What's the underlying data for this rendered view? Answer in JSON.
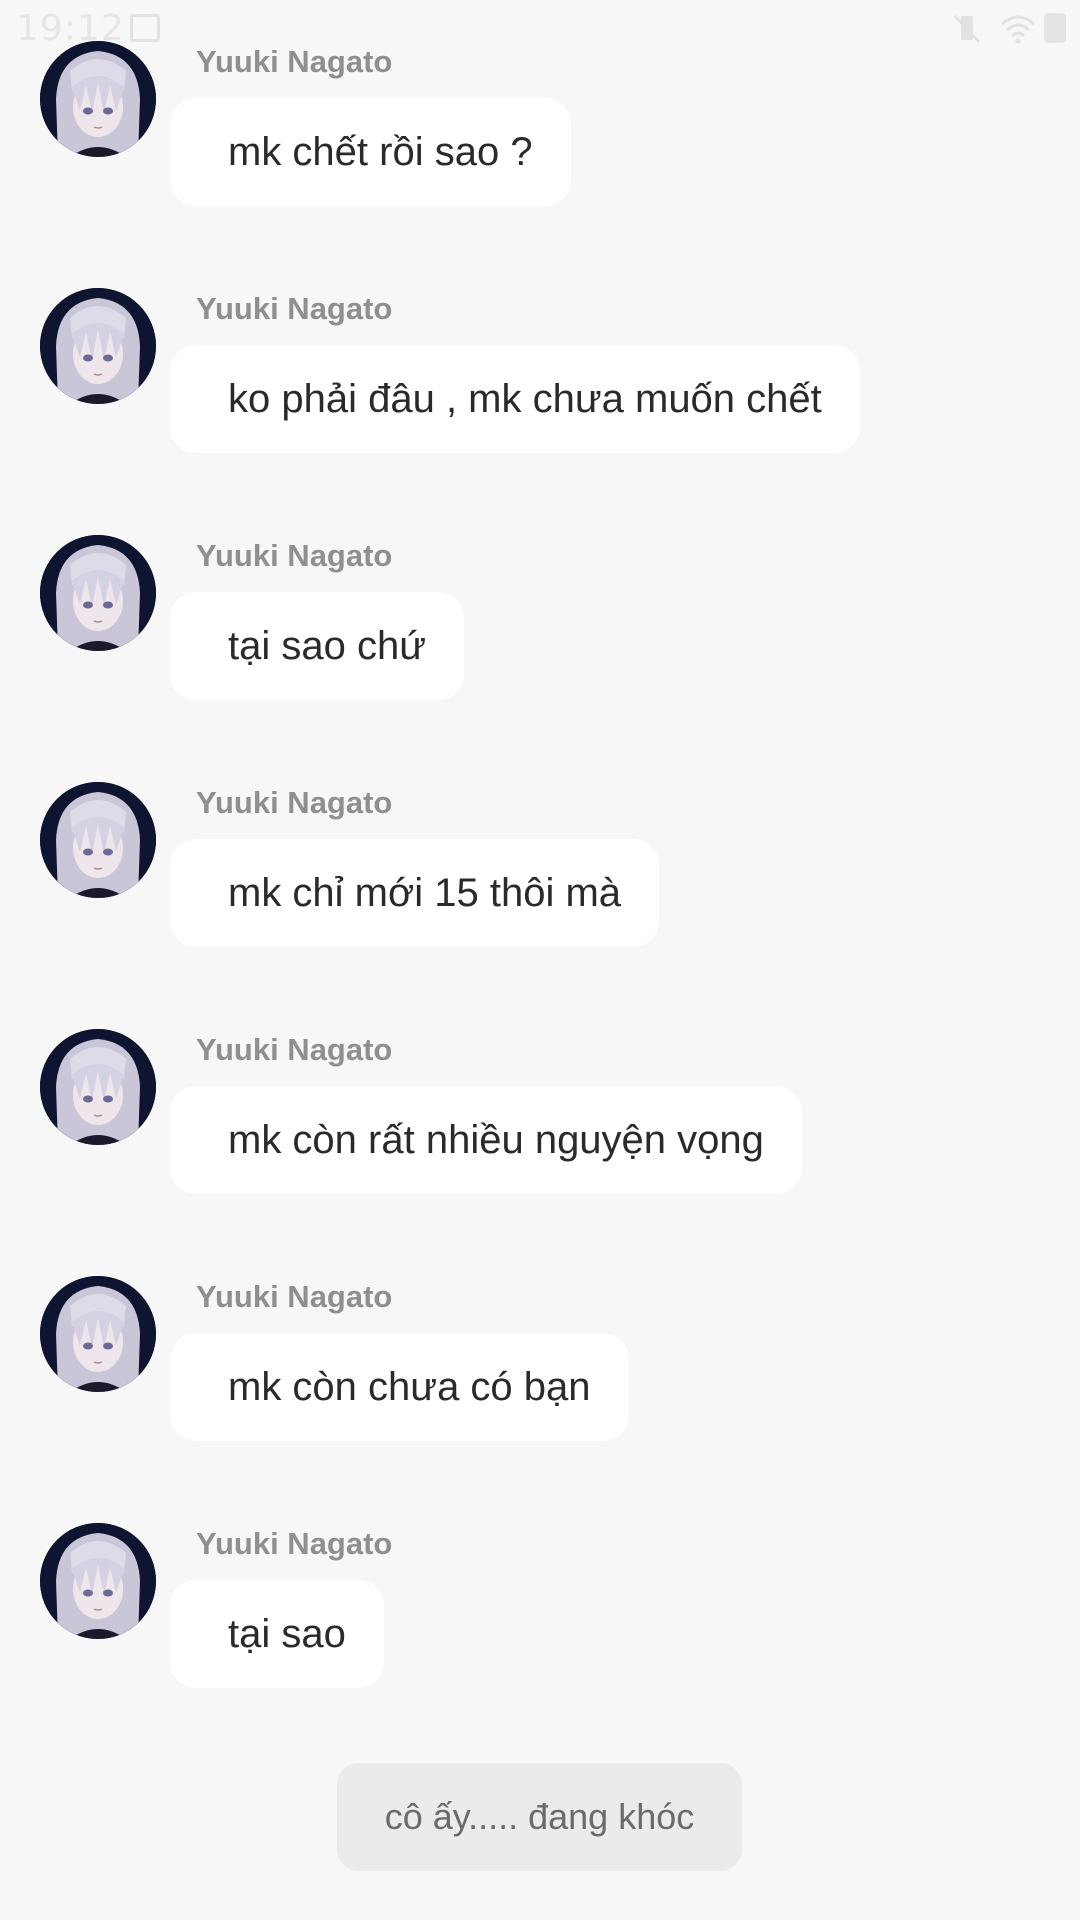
{
  "status_bar": {
    "time": "19:12",
    "icons": [
      "gallery-icon",
      "vibrate-icon",
      "wifi-icon",
      "battery-icon"
    ]
  },
  "chat": {
    "messages": [
      {
        "sender": "Yuuki Nagato",
        "text": "mk chết rồi sao ?"
      },
      {
        "sender": "Yuuki Nagato",
        "text": "ko phải đâu , mk chưa muốn chết"
      },
      {
        "sender": "Yuuki Nagato",
        "text": "tại sao chứ"
      },
      {
        "sender": "Yuuki Nagato",
        "text": "mk chỉ mới 15 thôi mà"
      },
      {
        "sender": "Yuuki Nagato",
        "text": "mk còn rất nhiều nguyện vọng"
      },
      {
        "sender": "Yuuki Nagato",
        "text": "mk còn chưa có bạn"
      },
      {
        "sender": "Yuuki Nagato",
        "text": "tại sao"
      }
    ],
    "system_note": "cô ấy..... đang khóc"
  },
  "colors": {
    "background": "#f7f7f7",
    "bubble": "#ffffff",
    "sender_name": "#8f8f8f",
    "system_note_bg": "#ebebeb"
  }
}
